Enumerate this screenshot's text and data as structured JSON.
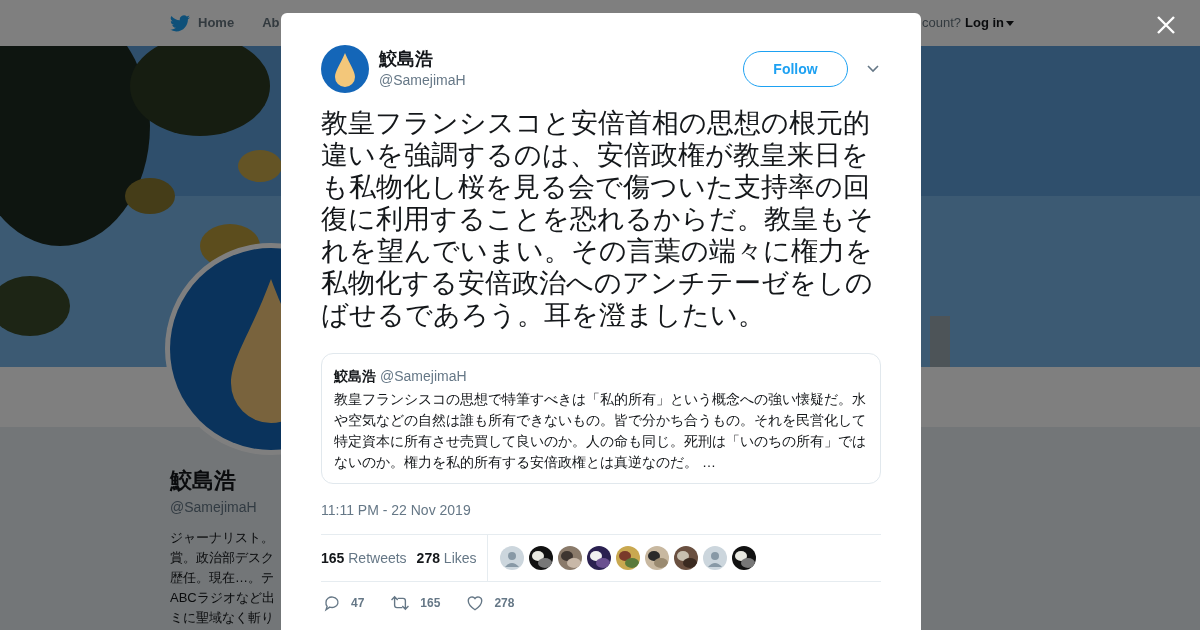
{
  "nav": {
    "items": [
      "Home",
      "Ab"
    ],
    "account_prompt": "count?",
    "login": "Log in"
  },
  "profile": {
    "name": "鮫島浩",
    "handle": "@SamejimaH",
    "bio_lines": [
      "ジャーナリスト。",
      "賞。政治部デスク",
      "歴任。現在…。テ",
      "ABCラジオなど出",
      "ミに聖域なく斬り"
    ]
  },
  "tweet": {
    "author": {
      "name": "鮫島浩",
      "handle": "@SamejimaH"
    },
    "follow_label": "Follow",
    "text": "教皇フランシスコと安倍首相の思想の根元的違いを強調するのは、安倍政権が教皇来日をも私物化し桜を見る会で傷ついた支持率の回復に利用することを恐れるからだ。教皇もそれを望んでいまい。その言葉の端々に権力を私物化する安倍政治へのアンチテーゼをしのばせるであろう。耳を澄ましたい。",
    "quote": {
      "name": "鮫島浩",
      "handle": "@SamejimaH",
      "text": "教皇フランシスコの思想で特筆すべきは「私的所有」という概念への強い懐疑だ。水や空気などの自然は誰も所有できないもの。皆で分かち合うもの。それを民営化して特定資本に所有させ売買して良いのか。人の命も同じ。死刑は「いのちの所有」ではないのか。権力を私的所有する安倍政権とは真逆なのだ。 …"
    },
    "timestamp": "11:11 PM - 22 Nov 2019",
    "stats": [
      {
        "count": "165",
        "label": "Retweets"
      },
      {
        "count": "278",
        "label": "Likes"
      }
    ],
    "likers": [
      {
        "kind": "default"
      },
      {
        "kind": "picture"
      },
      {
        "kind": "picture"
      },
      {
        "kind": "picture"
      },
      {
        "kind": "picture"
      },
      {
        "kind": "picture"
      },
      {
        "kind": "picture"
      },
      {
        "kind": "default"
      },
      {
        "kind": "picture"
      }
    ],
    "actions": [
      {
        "kind": "reply",
        "count": "47"
      },
      {
        "kind": "retweet",
        "count": "165"
      },
      {
        "kind": "like",
        "count": "278"
      }
    ]
  }
}
